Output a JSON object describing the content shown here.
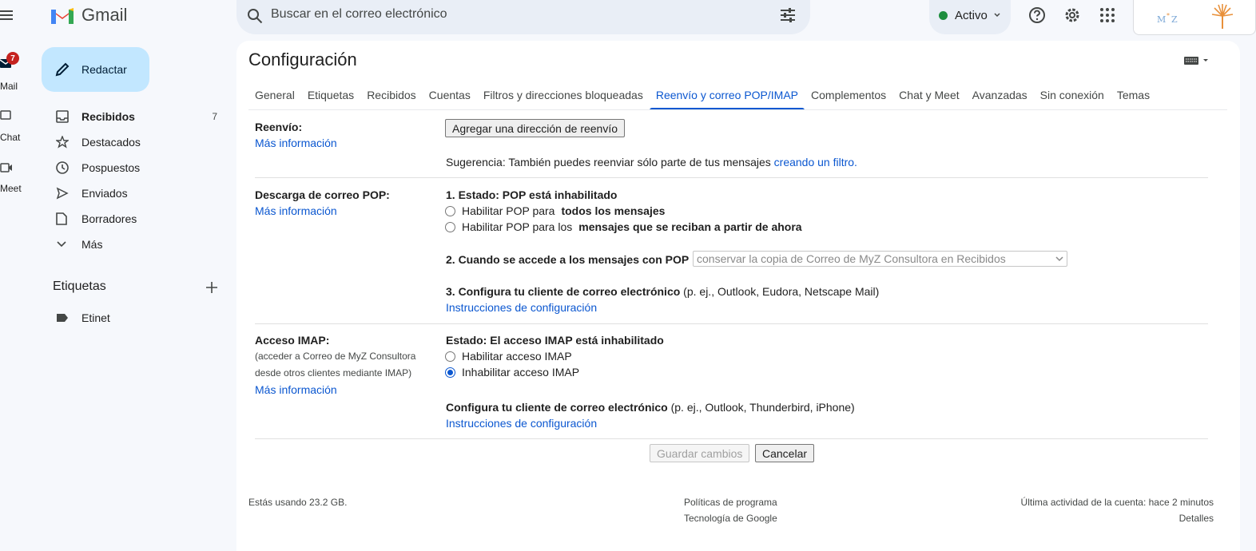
{
  "app": {
    "name": "Gmail"
  },
  "rail": {
    "mail_label": "Mail",
    "mail_badge": "7",
    "chat_label": "Chat",
    "meet_label": "Meet"
  },
  "search": {
    "placeholder": "Buscar en el correo electrónico"
  },
  "status": {
    "label": "Activo",
    "color": "#1e8e3e"
  },
  "account": {
    "logo_text": "MyZ"
  },
  "compose": {
    "label": "Redactar"
  },
  "nav": {
    "items": [
      {
        "label": "Recibidos",
        "count": "7",
        "icon": "inbox-icon"
      },
      {
        "label": "Destacados",
        "count": "",
        "icon": "star-icon"
      },
      {
        "label": "Pospuestos",
        "count": "",
        "icon": "clock-icon"
      },
      {
        "label": "Enviados",
        "count": "",
        "icon": "send-icon"
      },
      {
        "label": "Borradores",
        "count": "",
        "icon": "draft-icon"
      },
      {
        "label": "Más",
        "count": "",
        "icon": "chevron-down-icon"
      }
    ]
  },
  "labels": {
    "heading": "Etiquetas",
    "items": [
      {
        "label": "Etinet"
      }
    ]
  },
  "settings": {
    "title": "Configuración",
    "tabs": [
      "General",
      "Etiquetas",
      "Recibidos",
      "Cuentas",
      "Filtros y direcciones bloqueadas",
      "Reenvío y correo POP/IMAP",
      "Complementos",
      "Chat y Meet",
      "Avanzadas",
      "Sin conexión",
      "Temas"
    ],
    "active_tab": "Reenvío y correo POP/IMAP",
    "forwarding": {
      "title": "Reenvío:",
      "more_info": "Más información",
      "add_button": "Agregar una dirección de reenvío",
      "tip": "Sugerencia: También puedes reenviar sólo parte de tus mensajes",
      "tip_link": "creando un filtro."
    },
    "pop": {
      "title": "Descarga de correo POP:",
      "more_info": "Más información",
      "status": "1. Estado: POP está inhabilitado",
      "opt1_prefix": "Habilitar POP para",
      "opt1_bold": "todos los mensajes",
      "opt2_prefix": "Habilitar POP para los",
      "opt2_bold": "mensajes que se reciban a partir de ahora",
      "access_label": "2. Cuando se accede a los mensajes con POP",
      "access_select": "conservar la copia de Correo de MyZ Consultora en Recibidos",
      "configure_bold": "3. Configura tu cliente de correo electrónico",
      "configure_rest": " (p. ej., Outlook, Eudora, Netscape Mail)",
      "instructions": "Instrucciones de configuración"
    },
    "imap": {
      "title": "Acceso IMAP:",
      "desc_line1": "(acceder a Correo de MyZ Consultora",
      "desc_line2": "desde otros clientes mediante IMAP)",
      "more_info": "Más información",
      "status": "Estado: El acceso IMAP está inhabilitado",
      "opt_enable": "Habilitar acceso IMAP",
      "opt_disable": "Inhabilitar acceso IMAP",
      "configure_bold": "Configura tu cliente de correo electrónico",
      "configure_rest": " (p. ej., Outlook, Thunderbird, iPhone)",
      "instructions": "Instrucciones de configuración"
    },
    "save_button": "Guardar cambios",
    "cancel_button": "Cancelar"
  },
  "footer": {
    "storage": "Estás usando 23.2 GB.",
    "policies": "Políticas de programa",
    "powered": "Tecnología de Google",
    "last_activity": "Última actividad de la cuenta: hace 2 minutos",
    "details": "Detalles"
  }
}
